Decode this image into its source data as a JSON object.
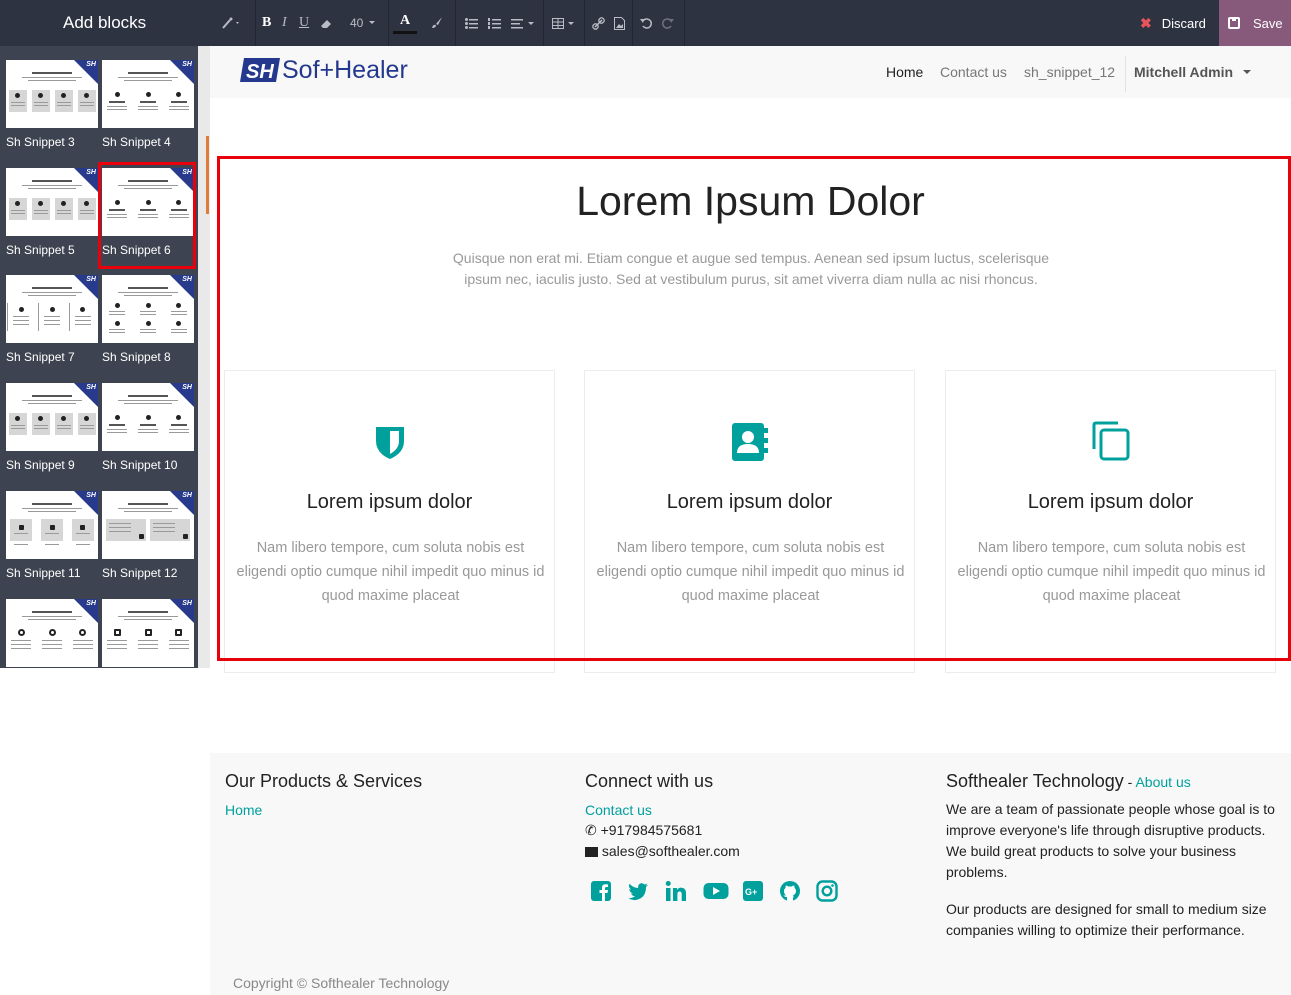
{
  "sidebar": {
    "title": "Add blocks",
    "snippets": [
      {
        "label": "Sh Snippet 3"
      },
      {
        "label": "Sh Snippet 4"
      },
      {
        "label": "Sh Snippet 5"
      },
      {
        "label": "Sh Snippet 6",
        "selected": true
      },
      {
        "label": "Sh Snippet 7"
      },
      {
        "label": "Sh Snippet 8"
      },
      {
        "label": "Sh Snippet 9"
      },
      {
        "label": "Sh Snippet 10"
      },
      {
        "label": "Sh Snippet 11"
      },
      {
        "label": "Sh Snippet 12"
      },
      {
        "label": ""
      },
      {
        "label": ""
      }
    ],
    "badge_text": "SH"
  },
  "toolbar": {
    "font_size": "40",
    "discard_label": "Discard",
    "save_label": "Save",
    "icons": [
      "magic-wand-icon",
      "bold-icon",
      "italic-icon",
      "underline-icon",
      "eraser-icon",
      "font-size-dropdown",
      "font-color-icon",
      "paint-brush-icon",
      "bullet-list-icon",
      "numbered-list-icon",
      "align-icon",
      "table-icon",
      "link-icon",
      "image-icon",
      "undo-icon",
      "redo-icon"
    ]
  },
  "navbar": {
    "logo_text": "Sof+Healer",
    "items": [
      {
        "label": "Home",
        "active": true
      },
      {
        "label": "Contact us"
      },
      {
        "label": "sh_snippet_12"
      }
    ],
    "user": "Mitchell Admin"
  },
  "main": {
    "title": "Lorem Ipsum Dolor",
    "subtitle": "Quisque non erat mi. Etiam congue et augue sed tempus. Aenean sed ipsum luctus, scelerisque ipsum nec, iaculis justo. Sed at vestibulum purus, sit amet viverra diam nulla ac nisi rhoncus.",
    "cards": [
      {
        "icon": "shield-icon",
        "title": "Lorem ipsum dolor",
        "text": "Nam libero tempore, cum soluta nobis est eligendi optio cumque nihil impedit quo minus id quod maxime placeat"
      },
      {
        "icon": "address-book-icon",
        "title": "Lorem ipsum dolor",
        "text": "Nam libero tempore, cum soluta nobis est eligendi optio cumque nihil impedit quo minus id quod maxime placeat"
      },
      {
        "icon": "copy-icon",
        "title": "Lorem ipsum dolor",
        "text": "Nam libero tempore, cum soluta nobis est eligendi optio cumque nihil impedit quo minus id quod maxime placeat"
      }
    ],
    "accent_color": "#00a09d"
  },
  "footer": {
    "col1": {
      "title": "Our Products & Services",
      "link": "Home"
    },
    "col2": {
      "title": "Connect with us",
      "link": "Contact us",
      "phone": "+917984575681",
      "email": "sales@softhealer.com",
      "social": [
        "facebook-icon",
        "twitter-icon",
        "linkedin-icon",
        "youtube-icon",
        "google-plus-icon",
        "github-icon",
        "instagram-icon"
      ]
    },
    "col3": {
      "title": "Softhealer Technology",
      "dash": " - ",
      "about": "About us",
      "p1": "We are a team of passionate people whose goal is to improve everyone's life through disruptive products. We build great products to solve your business problems.",
      "p2": "Our products are designed for small to medium size companies willing to optimize their performance."
    },
    "copyright": "Copyright © Softhealer Technology"
  }
}
